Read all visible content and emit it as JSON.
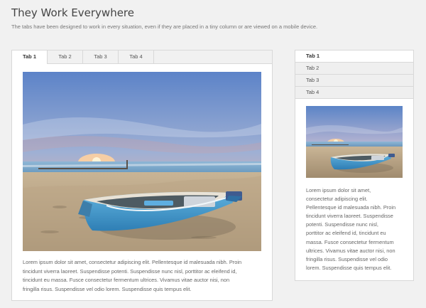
{
  "header": {
    "title": "They Work Everywhere",
    "subtitle": "The tabs have been designed to work in every situation, even if they are placed in a tiny column or are viewed on a mobile device."
  },
  "horizontal_tabs": {
    "tabs": [
      "Tab 1",
      "Tab 2",
      "Tab 3",
      "Tab 4"
    ],
    "active_index": 0,
    "image_description": "beach-sunset-boat-photo",
    "text_lines": [
      "Lorem ipsum dolor sit amet, consectetur adipiscing elit. Pellentesque id malesuada nibh. Proin",
      "tincidunt viverra laoreet. Suspendisse potenti. Suspendisse nunc nisl, porttitor ac eleifend id,",
      "tincidunt eu massa. Fusce consectetur fermentum ultrices. Vivamus vitae auctor nisi, non",
      "fringilla risus. Suspendisse vel odio lorem. Suspendisse quis tempus elit."
    ]
  },
  "vertical_tabs": {
    "tabs": [
      "Tab 1",
      "Tab 2",
      "Tab 3",
      "Tab 4"
    ],
    "active_index": 0,
    "image_description": "beach-sunset-boat-photo",
    "text_lines": [
      "Lorem ipsum dolor sit amet,",
      "consectetur adipiscing elit.",
      "Pellentesque id malesuada nibh. Proin",
      "tincidunt viverra laoreet. Suspendisse",
      "potenti. Suspendisse nunc nisl,",
      "porttitor ac eleifend id, tincidunt eu",
      "massa. Fusce consectetur fermentum",
      "ultrices. Vivamus vitae auctor nisi, non",
      "fringilla risus. Suspendisse vel odio",
      "lorem. Suspendisse quis tempus elit."
    ]
  },
  "colors": {
    "background": "#f1f1f1",
    "panel": "#ffffff",
    "border": "#d8d8d8",
    "text": "#666666",
    "title": "#444444"
  }
}
